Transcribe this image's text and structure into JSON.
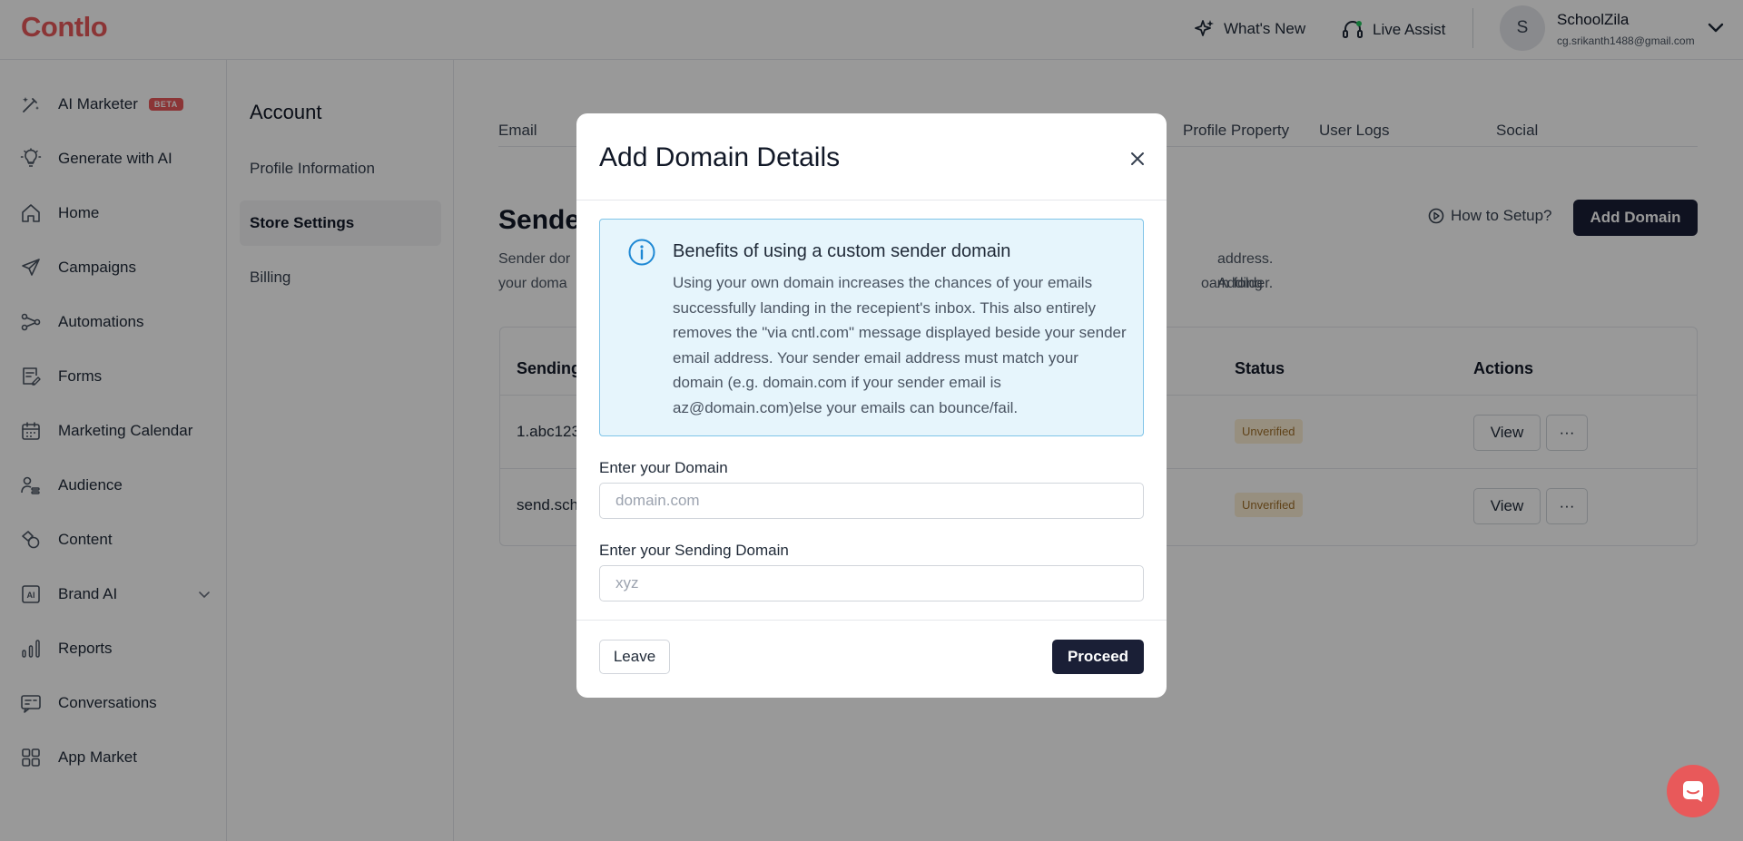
{
  "app": {
    "logo": "Contlo"
  },
  "topbar": {
    "whats_new": "What's New",
    "live_assist": "Live Assist",
    "avatar_initial": "S",
    "user_name": "SchoolZila",
    "user_email": "cg.srikanth1488@gmail.com"
  },
  "sidebar": {
    "items": [
      {
        "label": "AI Marketer",
        "icon": "magic-wand-icon",
        "badge": "BETA"
      },
      {
        "label": "Generate with AI",
        "icon": "lightbulb-icon"
      },
      {
        "label": "Home",
        "icon": "home-icon"
      },
      {
        "label": "Campaigns",
        "icon": "send-icon"
      },
      {
        "label": "Automations",
        "icon": "flow-icon"
      },
      {
        "label": "Forms",
        "icon": "form-icon"
      },
      {
        "label": "Marketing Calendar",
        "icon": "calendar-icon"
      },
      {
        "label": "Audience",
        "icon": "audience-icon"
      },
      {
        "label": "Content",
        "icon": "shapes-icon"
      },
      {
        "label": "Brand AI",
        "icon": "brand-ai-icon"
      },
      {
        "label": "Reports",
        "icon": "bar-chart-icon"
      },
      {
        "label": "Conversations",
        "icon": "chat-icon"
      },
      {
        "label": "App Market",
        "icon": "grid-icon"
      }
    ]
  },
  "settings": {
    "title": "Account",
    "items": [
      {
        "label": "Profile Information"
      },
      {
        "label": "Store Settings",
        "active": true
      },
      {
        "label": "Billing"
      }
    ]
  },
  "main": {
    "tabs": [
      {
        "label": "Email"
      },
      {
        "label": "Profile Property"
      },
      {
        "label": "User Logs"
      },
      {
        "label": "Social"
      }
    ],
    "title_partial": "Sende",
    "desc_left_1": "Sender dor",
    "desc_left_2": "your doma",
    "desc_right_1": "address. Adding",
    "desc_right_2": "oam folder.",
    "how_to_setup": "How to Setup?",
    "add_domain": "Add Domain",
    "table": {
      "headers": {
        "sending": "Sending",
        "status": "Status",
        "actions": "Actions"
      },
      "rows": [
        {
          "sending": "1.abc123",
          "status": "Unverified",
          "view": "View",
          "more": "···"
        },
        {
          "sending": "send.sch",
          "status": "Unverified",
          "view": "View",
          "more": "···"
        }
      ]
    }
  },
  "modal": {
    "title": "Add Domain Details",
    "info": {
      "title": "Benefits of using a custom sender domain",
      "body": "Using your own domain increases the chances of your emails successfully landing in the recepient's inbox. This also entirely removes the \"via cntl.com\" message displayed beside your sender email address. Your sender email address must match your domain (e.g. domain.com if your sender email is az@domain.com)else your emails can bounce/fail."
    },
    "domain_label": "Enter your Domain",
    "domain_placeholder": "domain.com",
    "domain_value": "",
    "sending_label": "Enter your Sending Domain",
    "sending_placeholder": "xyz",
    "sending_value": "",
    "leave": "Leave",
    "proceed": "Proceed"
  },
  "colors": {
    "brand": "#e8595a",
    "dark_button": "#1a1f36",
    "info_bg": "#e6f5fc",
    "info_border": "#7fc4e8",
    "badge_bg": "#fcefd4",
    "badge_text": "#a0702b"
  }
}
